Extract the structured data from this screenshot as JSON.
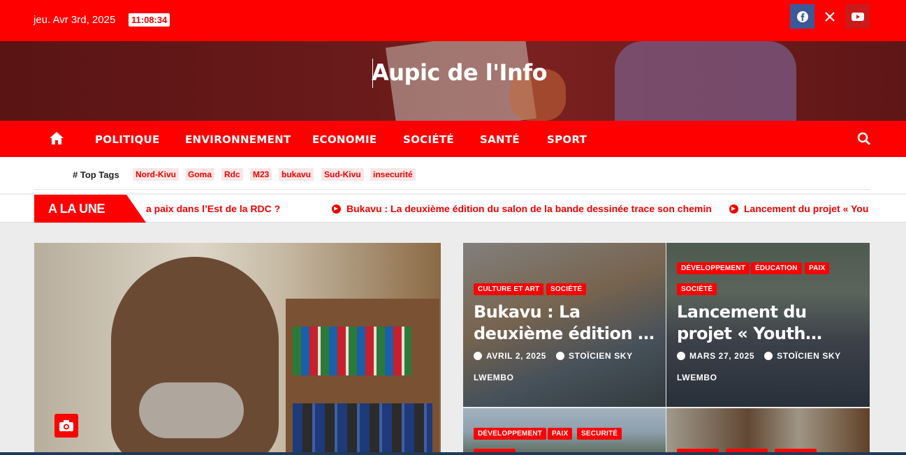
{
  "topbar": {
    "date": "jeu. Avr 3rd, 2025",
    "clock": "11:08:34",
    "social": [
      {
        "name": "facebook",
        "icon": "facebook-icon",
        "glyph": "f"
      },
      {
        "name": "x",
        "icon": "x-icon",
        "glyph": "𝕏"
      },
      {
        "name": "youtube",
        "icon": "youtube-icon",
        "glyph": "▶"
      }
    ]
  },
  "header": {
    "site_title": "Aupic de l'Info"
  },
  "nav": {
    "home_icon": "home-icon",
    "items": [
      "POLITIQUE",
      "ENVIRONNEMENT",
      "ECONOMIE",
      "SOCIÉTÉ",
      "SANTÉ",
      "SPORT"
    ],
    "search_icon": "search-icon"
  },
  "tags": {
    "label": "# Top Tags",
    "items": [
      "Nord-Kivu",
      "Goma",
      "Rdc",
      "M23",
      "bukavu",
      "Sud-Kivu",
      "insecurité"
    ]
  },
  "ticker": {
    "badge": "A LA UNE",
    "items": [
      "a paix dans l’Est de la RDC ?",
      "Bukavu : La deuxième édition du salon de la bande dessinée trace son chemin",
      "Lancement du projet « You"
    ]
  },
  "cards": [
    {
      "categories": [
        "CULTURE ET ART",
        "SOCIÉTÉ"
      ],
      "title_lines": [
        "Bukavu : La",
        "deuxième édition …"
      ],
      "date": "AVRIL 2, 2025",
      "author": "STOÏCIEN SKY",
      "author_line2": "LWEMBO"
    },
    {
      "categories": [
        "DÉVELOPPEMENT",
        "ÉDUCATION",
        "PAIX",
        "SOCIÉTÉ"
      ],
      "title_lines": [
        "Lancement du",
        "projet « Youth…"
      ],
      "date": "MARS 27, 2025",
      "author": "STOÏCIEN SKY",
      "author_line2": "LWEMBO"
    },
    {
      "categories": [
        "DÉVELOPPEMENT",
        "PAIX",
        "SECURITÉ"
      ]
    }
  ],
  "colors": {
    "brand_red": "#ff0000",
    "banner_dark": "#5e1616",
    "facebook": "#3b5998"
  }
}
